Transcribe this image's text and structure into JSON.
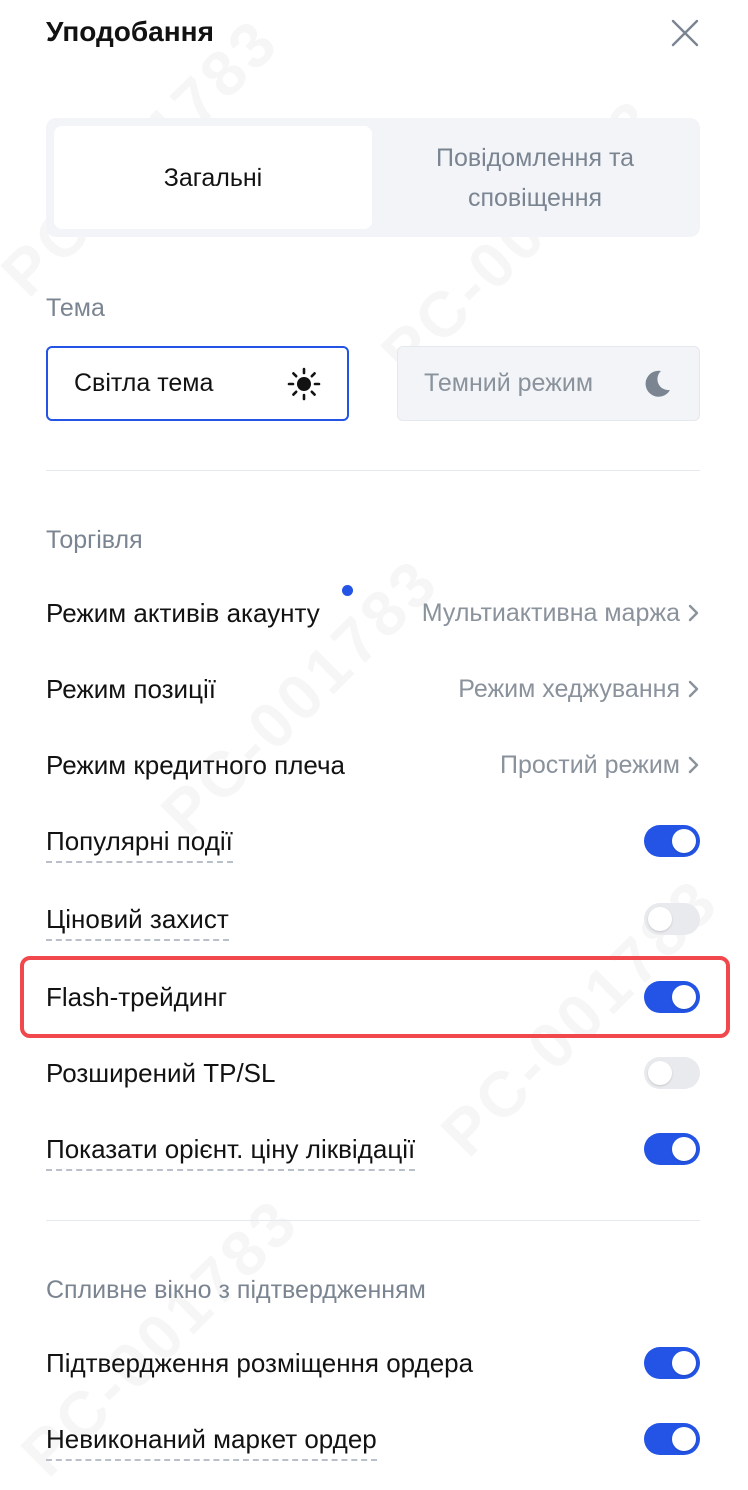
{
  "header": {
    "title": "Уподобання"
  },
  "tabs": [
    {
      "label": "Загальні",
      "active": true
    },
    {
      "label": "Повідомлення та сповіщення",
      "active": false
    }
  ],
  "theme": {
    "label": "Тема",
    "options": [
      {
        "label": "Світла тема",
        "icon": "sun-icon",
        "selected": true
      },
      {
        "label": "Темний режим",
        "icon": "moon-icon",
        "selected": false
      }
    ]
  },
  "trading": {
    "label": "Торгівля",
    "settings": [
      {
        "label": "Режим активів акаунту",
        "value": "Мультиактивна маржа"
      },
      {
        "label": "Режим позиції",
        "value": "Режим хеджування"
      },
      {
        "label": "Режим кредитного плеча",
        "value": "Простий режим"
      }
    ],
    "toggles": [
      {
        "label": "Популярні події",
        "on": true
      },
      {
        "label": "Ціновий захист",
        "on": false
      },
      {
        "label": "Flash-трейдинг",
        "on": true
      },
      {
        "label": "Розширений TP/SL",
        "on": false
      },
      {
        "label": "Показати орієнт. ціну ліквідації",
        "on": true
      }
    ]
  },
  "confirm": {
    "label": "Спливне вікно з підтвердженням",
    "toggles": [
      {
        "label": "Підтвердження розміщення ордера",
        "on": true
      },
      {
        "label": "Невиконаний маркет ордер",
        "on": true
      }
    ]
  },
  "watermark": "PC-001783",
  "colors": {
    "accent": "#2354e6",
    "highlight": "#f0484c",
    "muted": "#7b8591"
  }
}
